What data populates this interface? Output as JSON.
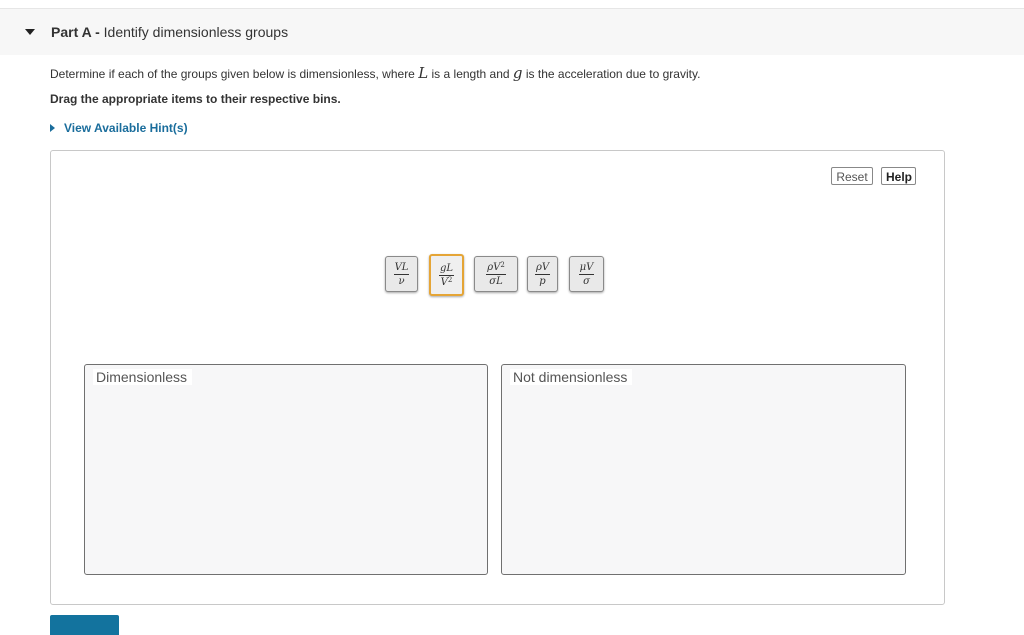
{
  "part": {
    "prefix": "Part A -",
    "title": "Identify dimensionless groups"
  },
  "instructions": {
    "text_before_L": "Determine if each of the groups given below is dimensionless, where",
    "var_L": "L",
    "text_between": "is a length and",
    "var_g": "g",
    "text_after_g": "is the acceleration due to gravity."
  },
  "drag_note": "Drag the appropriate items to their respective bins.",
  "hint_link": "View Available Hint(s)",
  "toolbar": {
    "reset_label": "Reset",
    "help_label": "Help"
  },
  "tiles": [
    {
      "num": "VL",
      "num_sup": "",
      "den": "ν",
      "den_sup": "",
      "selected": false
    },
    {
      "num": "gL",
      "num_sup": "",
      "den": "V",
      "den_sup": "2",
      "selected": true
    },
    {
      "num": "ρV",
      "num_sup": "2",
      "den": "σL",
      "den_sup": "",
      "selected": false
    },
    {
      "num": "ρV",
      "num_sup": "",
      "den": "p",
      "den_sup": "",
      "selected": false
    },
    {
      "num": "μV",
      "num_sup": "",
      "den": "σ",
      "den_sup": "",
      "selected": false
    }
  ],
  "bins": [
    {
      "label": "Dimensionless"
    },
    {
      "label": "Not dimensionless"
    }
  ],
  "colors": {
    "accent": "#1a6d9c",
    "submit": "#13739e",
    "selected_border": "#e5a536"
  },
  "icons": {
    "part_toggle": "caret-down-icon",
    "hint_toggle": "caret-right-icon"
  }
}
